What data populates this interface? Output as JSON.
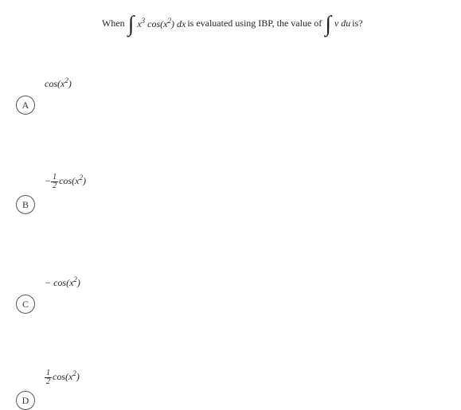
{
  "question": {
    "pre": "When",
    "int1_expr_base": "x",
    "int1_expr_p1": "3",
    "int1_cos_arg_base": "x",
    "int1_cos_arg_p": "2",
    "int1_dx": "dx",
    "mid": "is evaluated using IBP, the value of",
    "int2_v": "v",
    "int2_du": "du",
    "tail": "is?"
  },
  "options": {
    "A": {
      "label": "A",
      "text_html": "cos(x²)"
    },
    "B": {
      "label": "B",
      "text_html": "− ½ cos(x²)"
    },
    "C": {
      "label": "C",
      "text_html": "− cos(x²)"
    },
    "D": {
      "label": "D",
      "text_html": "½ cos(x²)"
    }
  }
}
